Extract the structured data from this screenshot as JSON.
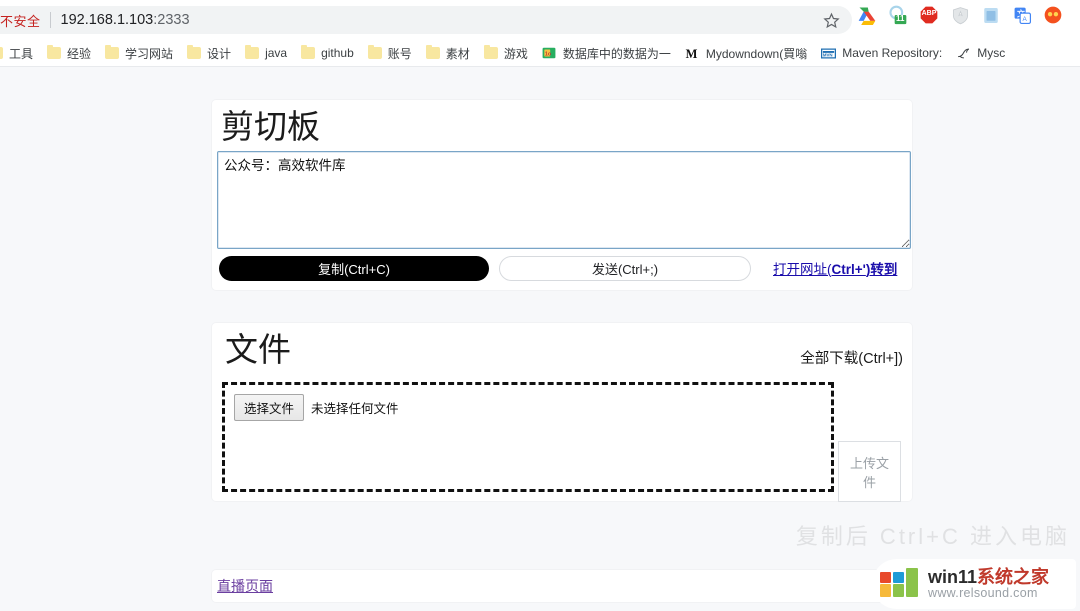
{
  "browser": {
    "security_chip": "不安全",
    "url_host": "192.168.1.103",
    "url_port": ":2333",
    "star_icon": "star-icon",
    "extensions": [
      {
        "name": "google-drive-icon",
        "glyph": ""
      },
      {
        "name": "calendar-extension-icon",
        "glyph": "11"
      },
      {
        "name": "adblock-plus-icon",
        "glyph": "ABP"
      },
      {
        "name": "shield-extension-icon",
        "glyph": ""
      },
      {
        "name": "notes-extension-icon",
        "glyph": ""
      },
      {
        "name": "google-translate-icon",
        "glyph": ""
      },
      {
        "name": "orange-extension-icon",
        "glyph": ""
      }
    ],
    "bookmarks": [
      {
        "label": "工具",
        "type": "folder"
      },
      {
        "label": "经验",
        "type": "folder"
      },
      {
        "label": "学习网站",
        "type": "folder"
      },
      {
        "label": "设计",
        "type": "folder"
      },
      {
        "label": "java",
        "type": "folder"
      },
      {
        "label": "github",
        "type": "folder"
      },
      {
        "label": "账号",
        "type": "folder"
      },
      {
        "label": "素材",
        "type": "folder"
      },
      {
        "label": "游戏",
        "type": "folder"
      },
      {
        "label": "数据库中的数据为一",
        "type": "site"
      },
      {
        "label": "Mydowndown(買嗡",
        "type": "site"
      },
      {
        "label": "Maven Repository:",
        "type": "site"
      },
      {
        "label": "Mysc",
        "type": "site"
      }
    ]
  },
  "clipboard": {
    "title": "剪切板",
    "textarea_value": "公众号：高效软件库",
    "textarea_placeholder": "",
    "copy_label": "复制(Ctrl+C)",
    "send_label": "发送(Ctrl+;)",
    "open_url_prefix": "打开网址(",
    "open_url_shortcut": "Ctrl+'",
    "open_url_suffix": ")转到"
  },
  "files": {
    "title": "文件",
    "download_all_label": "全部下载(Ctrl+])",
    "choose_file_label": "选择文件",
    "no_file_text": "未选择任何文件",
    "upload_label": "上传文件"
  },
  "live": {
    "link_label": "直播页面"
  },
  "watermark": {
    "brand_prefix": "win11",
    "brand_suffix": "系统之家",
    "url": "www.relsound.com",
    "ghost_text": "复制后 Ctrl+C 进入电脑"
  },
  "colors": {
    "accent_link": "#1a0dab",
    "visited_link": "#6b3fa0",
    "primary_button_bg": "#000000",
    "page_bg": "#f7f8fa",
    "insecure_red": "#c5221f"
  }
}
